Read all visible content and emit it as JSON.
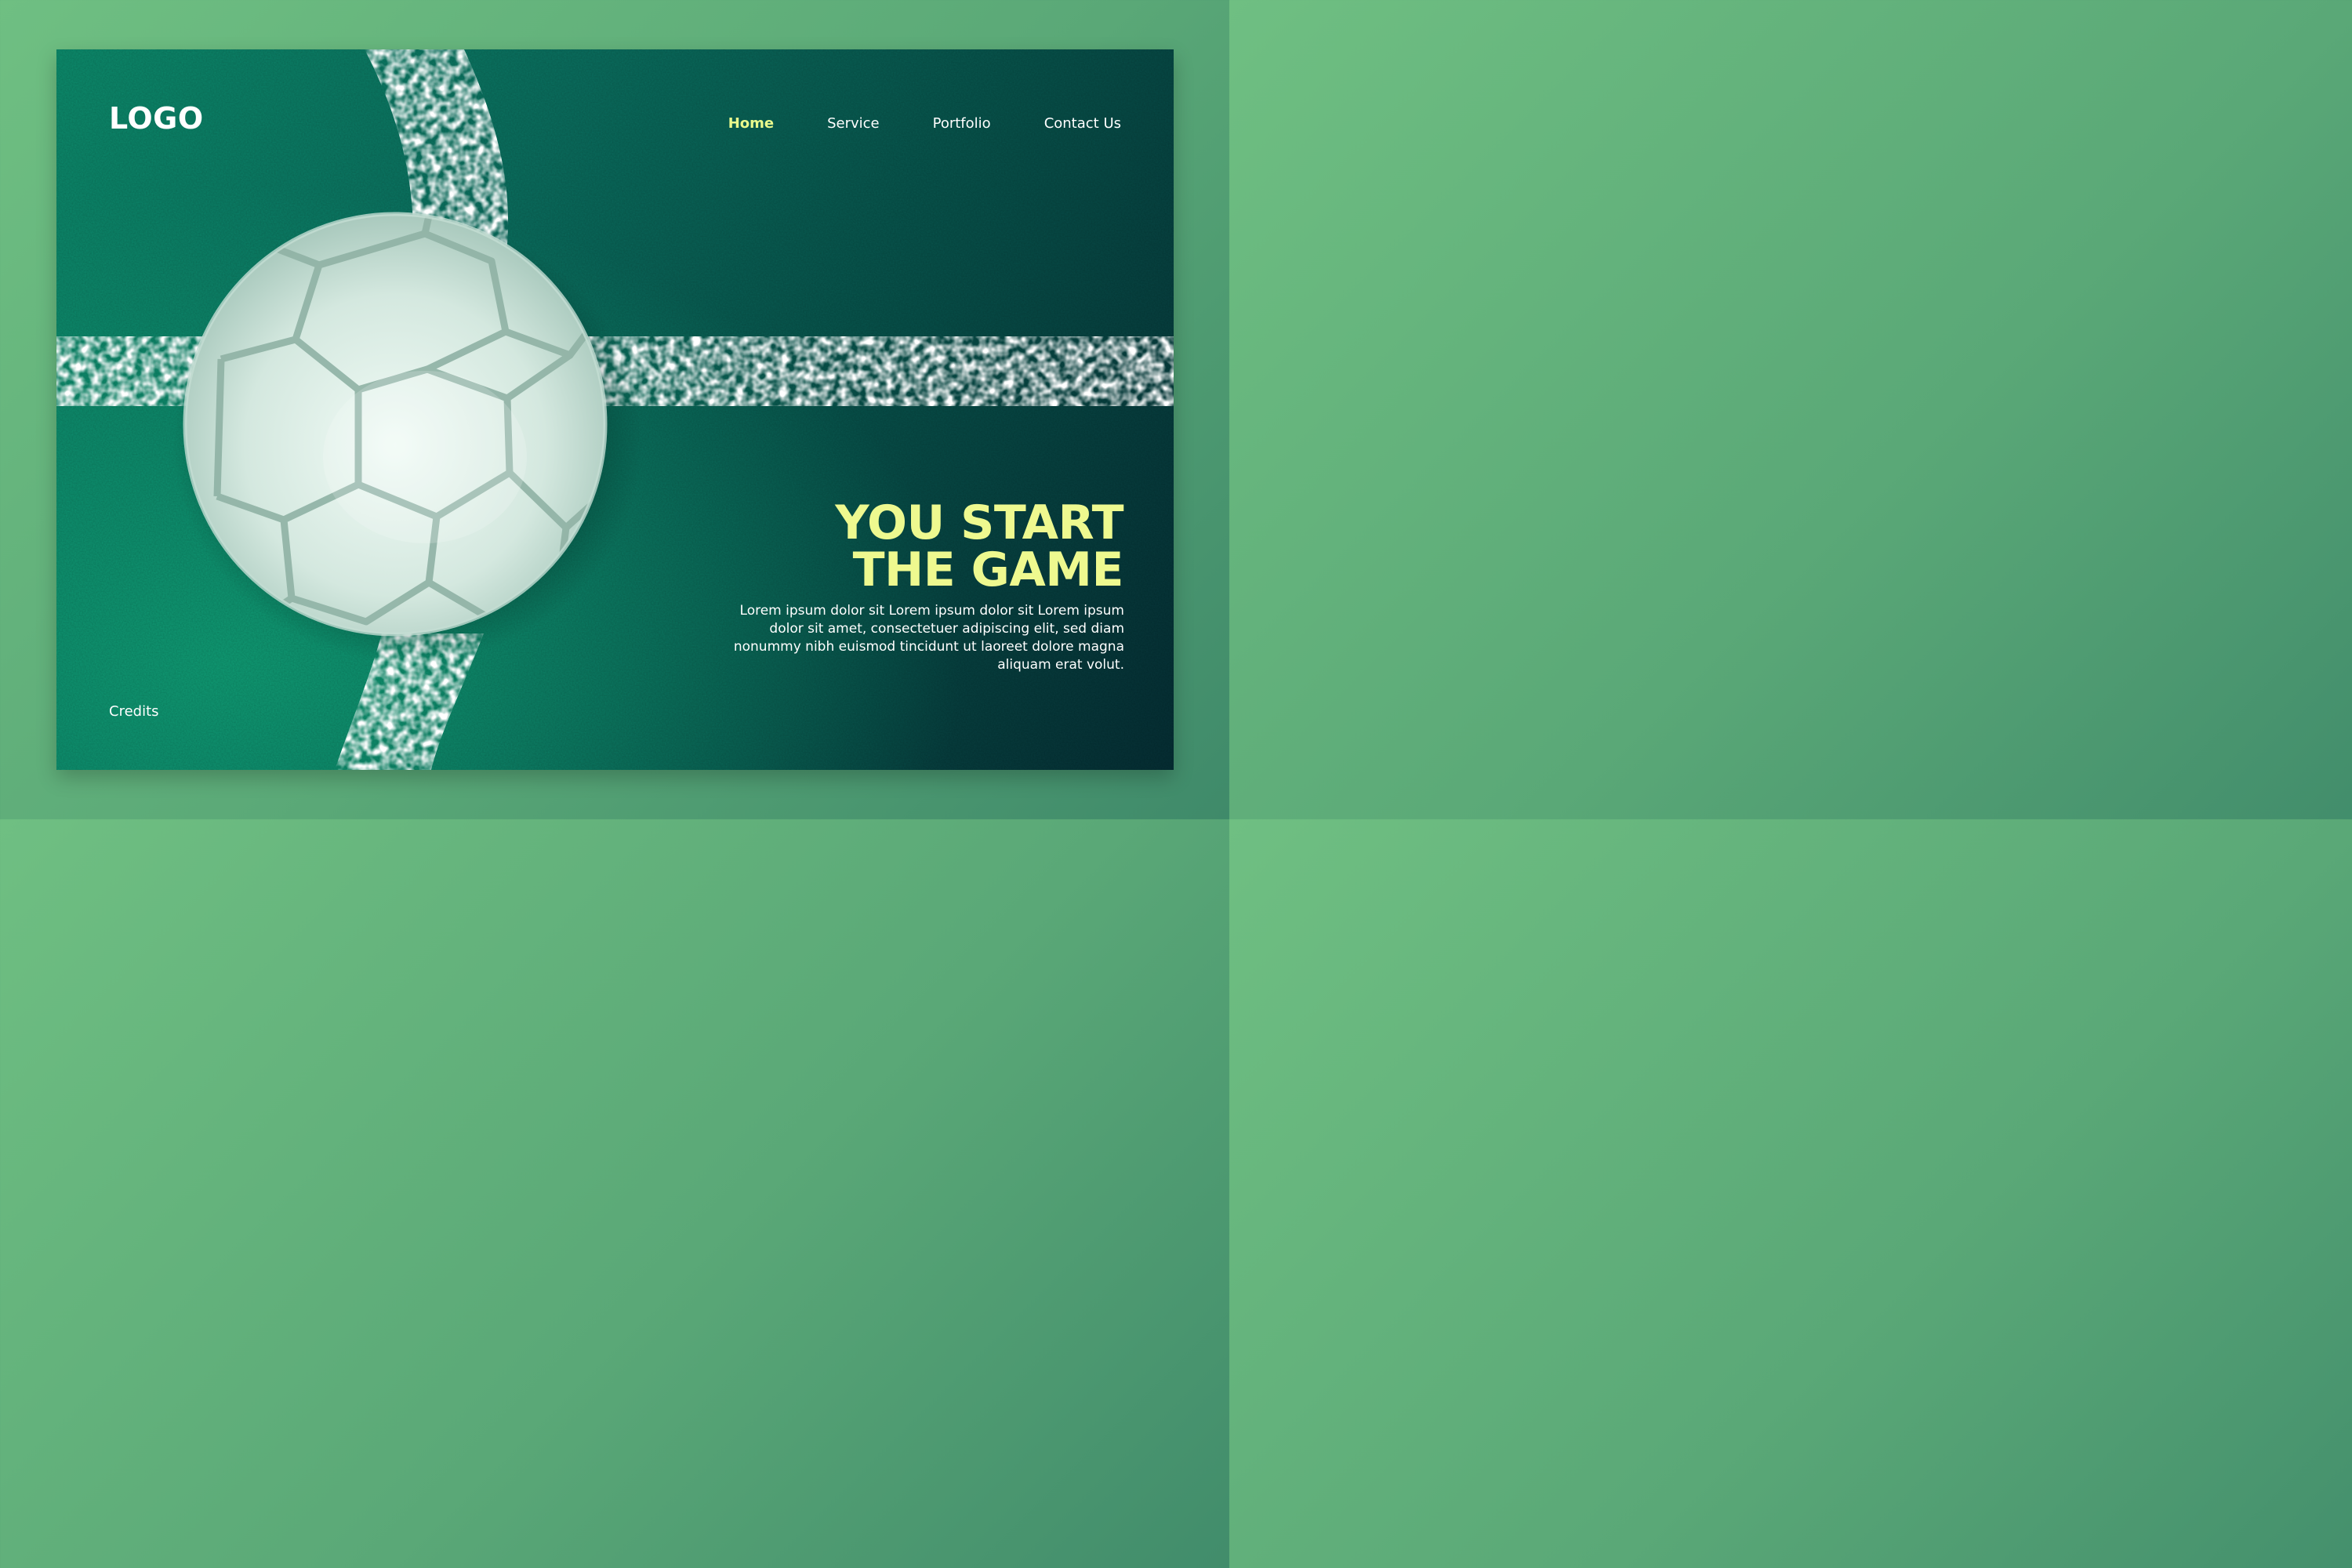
{
  "header": {
    "logo": "LOGO",
    "nav": [
      {
        "label": "Home",
        "active": true
      },
      {
        "label": "Service",
        "active": false
      },
      {
        "label": "Portfolio",
        "active": false
      },
      {
        "label": "Contact Us",
        "active": false
      }
    ]
  },
  "hero": {
    "headline_line1": "YOU START",
    "headline_line2": "THE GAME",
    "description": "Lorem ipsum dolor sit Lorem ipsum dolor sit Lorem ipsum dolor sit amet, consectetuer adipiscing elit, sed diam nonummy nibh euismod tincidunt ut laoreet dolore magna aliquam erat volut."
  },
  "footer": {
    "credits": "Credits"
  },
  "colors": {
    "accent": "#eef98f",
    "page_background": "#6fbf82",
    "field_dark": "#052e34",
    "field_light": "#0f9c74"
  }
}
